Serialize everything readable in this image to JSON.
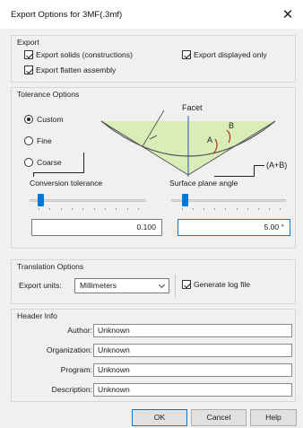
{
  "window": {
    "title": "Export Options for 3MF(.3mf)",
    "close_glyph": "✕"
  },
  "export": {
    "title": "Export",
    "solids_label": "Export solids (constructions)",
    "flatten_label": "Export flatten assembly",
    "displayed_only_label": "Export displayed only",
    "solids_checked": true,
    "flatten_checked": true,
    "displayed_only_checked": true
  },
  "tolerance": {
    "title": "Tolerance Options",
    "radios": [
      {
        "label": "Custom",
        "selected": true
      },
      {
        "label": "Fine",
        "selected": false
      },
      {
        "label": "Coarse",
        "selected": false
      }
    ],
    "diagram": {
      "facet_label": "Facet",
      "a_label": "A",
      "b_label": "B",
      "ab_label": "(A+B)"
    },
    "conversion_label": "Conversion tolerance",
    "conversion_value": "0.100",
    "angle_label": "Surface plane angle",
    "angle_value": "5.00 °",
    "accent_color": "#0078d7"
  },
  "translation": {
    "title": "Translation Options",
    "units_label": "Export units:",
    "units_value": "Millimeters",
    "log_label": "Generate log file",
    "log_checked": true
  },
  "header": {
    "title": "Header Info",
    "fields": [
      {
        "label": "Author:",
        "value": "Unknown"
      },
      {
        "label": "Organization:",
        "value": "Unknown"
      },
      {
        "label": "Program:",
        "value": "Unknown"
      },
      {
        "label": "Description:",
        "value": "Unknown"
      }
    ]
  },
  "buttons": {
    "ok": "OK",
    "cancel": "Cancel",
    "help": "Help"
  }
}
